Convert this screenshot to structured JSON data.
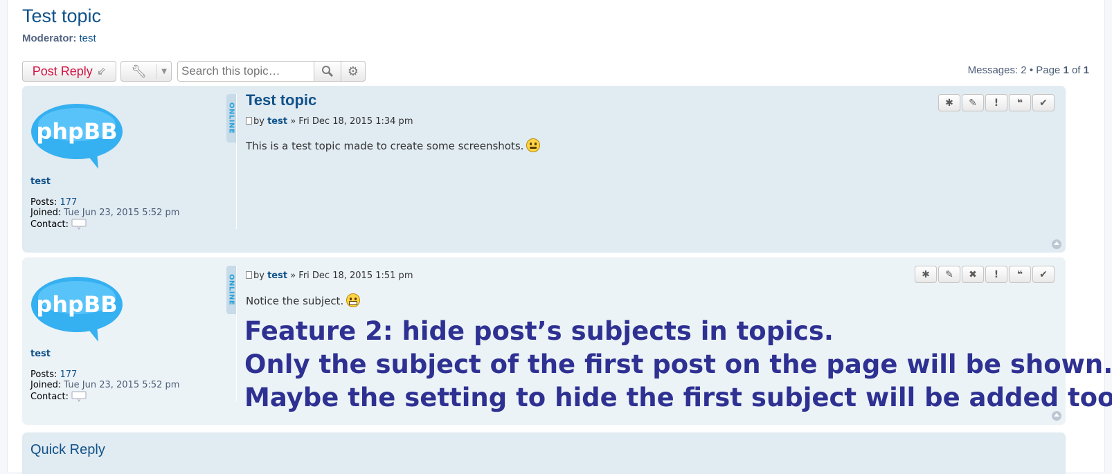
{
  "header": {
    "topic_title": "Test topic",
    "moderator_label": "Moderator:",
    "moderator_name": "test"
  },
  "toolbar": {
    "post_reply_label": "Post Reply",
    "search_placeholder": "Search this topic…",
    "messages_label": "Messages: 2 • Page",
    "page_current": "1",
    "page_of": "of",
    "page_total": "1"
  },
  "posts": [
    {
      "subject": "Test topic",
      "by": "by",
      "author": "test",
      "date": "» Fri Dec 18, 2015 1:34 pm",
      "content": "This is a test topic made to create some screenshots.",
      "online": "ONLINE",
      "avatar_text": "phpBB",
      "profile": {
        "name": "test",
        "posts_label": "Posts:",
        "posts": "177",
        "joined_label": "Joined:",
        "joined": "Tue Jun 23, 2015 5:52 pm",
        "contact_label": "Contact:"
      }
    },
    {
      "subject": "",
      "by": "by",
      "author": "test",
      "date": "» Fri Dec 18, 2015 1:51 pm",
      "content": "Notice the subject.",
      "online": "ONLINE",
      "avatar_text": "phpBB",
      "profile": {
        "name": "test",
        "posts_label": "Posts:",
        "posts": "177",
        "joined_label": "Joined:",
        "joined": "Tue Jun 23, 2015 5:52 pm",
        "contact_label": "Contact:"
      }
    }
  ],
  "overlay": {
    "line1": "Feature 2: hide post’s subjects in topics.",
    "line2": "Only the subject of the first post on the page will be shown.",
    "line3": "Maybe the setting to hide the first subject will be added too."
  },
  "quick_reply": {
    "title": "Quick Reply"
  },
  "colors": {
    "link": "#105289",
    "post_bg_1": "#e1ebf2",
    "post_bg_2": "#ecf3f7",
    "post_reply": "#d31141",
    "overlay_text": "#2e3192"
  }
}
